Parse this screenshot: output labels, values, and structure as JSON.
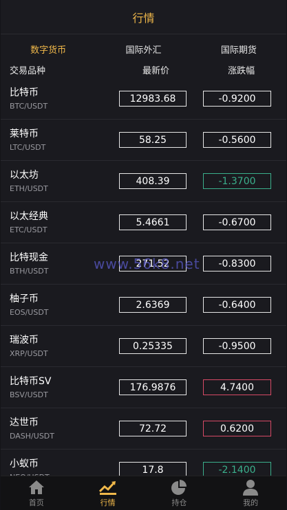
{
  "header": {
    "title": "行情"
  },
  "tabs": [
    {
      "label": "数字货币",
      "active": true
    },
    {
      "label": "国际外汇",
      "active": false
    },
    {
      "label": "国际期货",
      "active": false
    }
  ],
  "columns": {
    "symbol": "交易品种",
    "price": "最新价",
    "change": "涨跌幅"
  },
  "rows": [
    {
      "name": "比特币",
      "pair": "BTC/USDT",
      "price": "12983.68",
      "change": "-0.9200",
      "trend": "flat"
    },
    {
      "name": "莱特币",
      "pair": "LTC/USDT",
      "price": "58.25",
      "change": "-0.5600",
      "trend": "flat"
    },
    {
      "name": "以太坊",
      "pair": "ETH/USDT",
      "price": "408.39",
      "change": "-1.3700",
      "trend": "up"
    },
    {
      "name": "以太经典",
      "pair": "ETC/USDT",
      "price": "5.4661",
      "change": "-0.6700",
      "trend": "flat"
    },
    {
      "name": "比特现金",
      "pair": "BTH/USDT",
      "price": "271.52",
      "change": "-0.8300",
      "trend": "flat"
    },
    {
      "name": "柚子币",
      "pair": "EOS/USDT",
      "price": "2.6369",
      "change": "-0.6400",
      "trend": "flat"
    },
    {
      "name": "瑞波币",
      "pair": "XRP/USDT",
      "price": "0.25335",
      "change": "-0.9500",
      "trend": "flat"
    },
    {
      "name": "比特币SV",
      "pair": "BSV/USDT",
      "price": "176.9876",
      "change": "4.7400",
      "trend": "down"
    },
    {
      "name": "达世币",
      "pair": "DASH/USDT",
      "price": "72.72",
      "change": "0.6200",
      "trend": "down"
    },
    {
      "name": "小蚁币",
      "pair": "NEO/USDT",
      "price": "17.8",
      "change": "-2.1400",
      "trend": "up"
    }
  ],
  "watermark": "www.56k8.net",
  "tabbar": [
    {
      "label": "首页",
      "icon": "home-icon",
      "active": false
    },
    {
      "label": "行情",
      "icon": "chart-icon",
      "active": true
    },
    {
      "label": "持仓",
      "icon": "pie-chart-icon",
      "active": false
    },
    {
      "label": "我的",
      "icon": "user-icon",
      "active": false
    }
  ],
  "colors": {
    "accent": "#f0b84a",
    "up": "#3bb08c",
    "down": "#d84a66"
  }
}
